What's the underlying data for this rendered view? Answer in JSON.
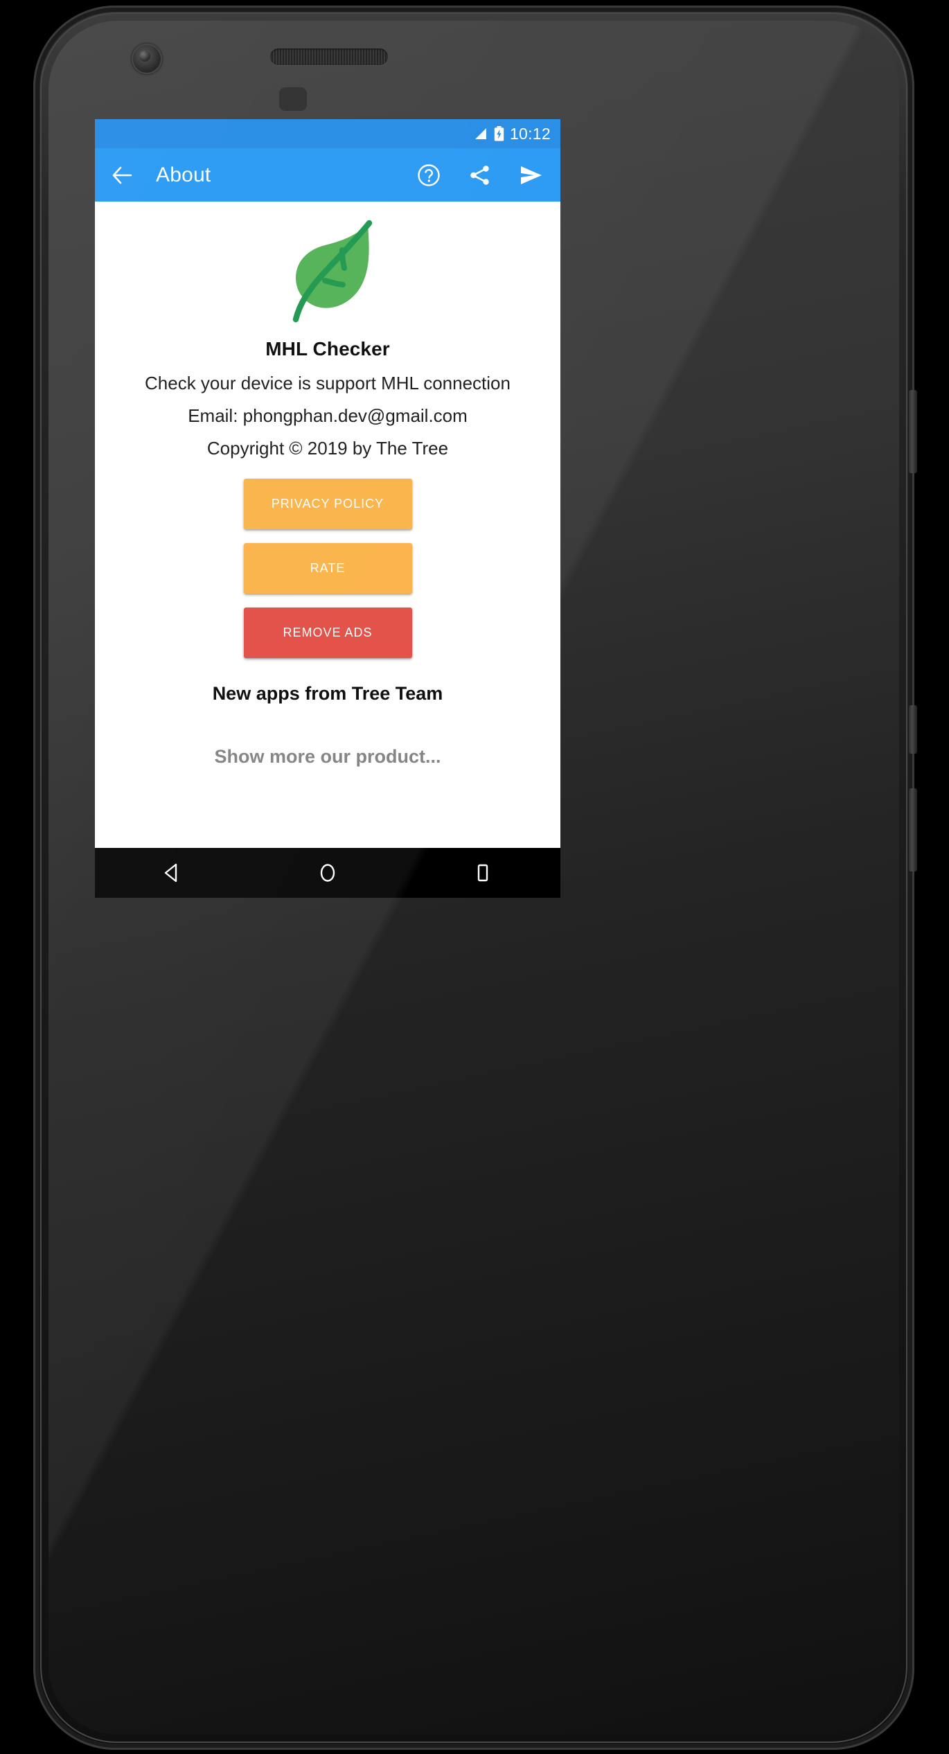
{
  "status_bar": {
    "clock": "10:12",
    "signal_icon": "signal-bars-icon",
    "battery_icon": "battery-charging-icon",
    "background_color": "#1e88e5"
  },
  "app_bar": {
    "title": "About",
    "back_icon": "arrow-back-icon",
    "background_color": "#2196f3",
    "actions": [
      {
        "name": "help-icon",
        "label": "Help"
      },
      {
        "name": "share-icon",
        "label": "Share"
      },
      {
        "name": "send-icon",
        "label": "Send"
      }
    ]
  },
  "content": {
    "logo_icon": "leaf-logo-icon",
    "logo_colors": {
      "leaf": "#4caf4f",
      "stem": "#159347"
    },
    "app_name": "MHL Checker",
    "description": "Check your device is support MHL connection",
    "email": "Email: phongphan.dev@gmail.com",
    "copyright": "Copyright © 2019 by The Tree",
    "buttons": [
      {
        "label": "PRIVACY POLICY",
        "color": "#fbb042",
        "style": "orange"
      },
      {
        "label": "RATE",
        "color": "#fbb042",
        "style": "orange"
      },
      {
        "label": "REMOVE ADS",
        "color": "#e2483f",
        "style": "red"
      }
    ],
    "new_apps_title": "New apps from Tree Team",
    "show_more": "Show more our product..."
  },
  "nav_bar": {
    "background_color": "#000000",
    "buttons": [
      {
        "name": "nav-back-icon",
        "label": "Back"
      },
      {
        "name": "nav-home-icon",
        "label": "Home"
      },
      {
        "name": "nav-recents-icon",
        "label": "Recents"
      }
    ]
  }
}
